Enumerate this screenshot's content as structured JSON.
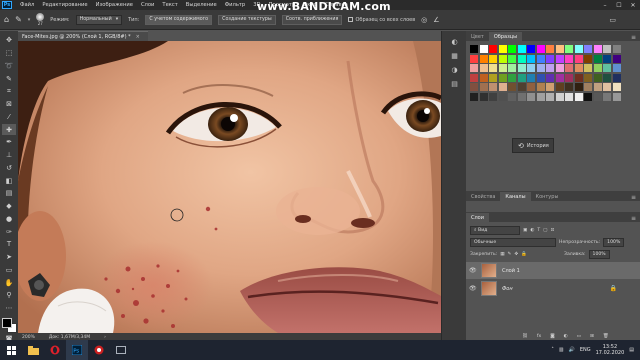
{
  "app": {
    "logo": "Ps"
  },
  "menu": [
    "Файл",
    "Редактирование",
    "Изображение",
    "Слои",
    "Текст",
    "Выделение",
    "Фильтр",
    "3D",
    "Просмотр",
    "Окно",
    "Справка"
  ],
  "watermark": "www.BANDICAM.com",
  "options": {
    "brush_size": "27",
    "mode_label": "Режим:",
    "mode_value": "Нормальный",
    "type_label": "Тип:",
    "btn_content": "С учетом содержимого",
    "btn_texture": "Создание текстуры",
    "btn_approx": "Соотв. приближения",
    "sample_all": "Образец со всех слоев"
  },
  "document": {
    "tab_title": "Face-Mites.jpg @ 200% (Слой 1, RGB/8#) *",
    "close": "×"
  },
  "status": {
    "zoom": "200%",
    "doc_info": "Док: 1,67M/3,34M"
  },
  "swatches_panel": {
    "tabs": [
      "Цвет",
      "Образцы"
    ],
    "active": 1
  },
  "swatch_colors": [
    [
      "#000000",
      "#ffffff",
      "#ff0000",
      "#ffff00",
      "#00ff00",
      "#00ffff",
      "#0000ff",
      "#ff00ff",
      "#ff8040",
      "#ffc080",
      "#80ff80",
      "#80ffff",
      "#8080ff",
      "#ff80ff",
      "#c0c0c0",
      "#808080"
    ],
    [
      "#ff4040",
      "#ff8000",
      "#ffd000",
      "#c0ff00",
      "#40ff40",
      "#00ffc0",
      "#00c0ff",
      "#4080ff",
      "#8040ff",
      "#c040ff",
      "#ff40c0",
      "#ff4080",
      "#804000",
      "#008040",
      "#004080",
      "#400080"
    ],
    [
      "#f0a0a0",
      "#f0c090",
      "#f0e090",
      "#d0f090",
      "#a0f0a0",
      "#90f0d0",
      "#90d0f0",
      "#a0b0f0",
      "#c0a0f0",
      "#f0a0e0",
      "#e07070",
      "#e09060",
      "#d0c060",
      "#90d060",
      "#60c0a0",
      "#6090d0"
    ],
    [
      "#c04040",
      "#c06020",
      "#b0a020",
      "#70a020",
      "#30a040",
      "#20a080",
      "#2080b0",
      "#3050b0",
      "#6030b0",
      "#a030a0",
      "#a03060",
      "#703020",
      "#806020",
      "#406020",
      "#205040",
      "#203060"
    ],
    [
      "#805040",
      "#a07050",
      "#c09070",
      "#e0b090",
      "#705030",
      "#504030",
      "#906040",
      "#b08050",
      "#d0a070",
      "#604020",
      "#403020",
      "#302010",
      "#a08060",
      "#c0a080",
      "#e0c0a0",
      "#f0e0c0"
    ],
    [
      "#202020",
      "#303030",
      "#404040",
      "#505050",
      "#606060",
      "#707070",
      "#909090",
      "#a0a0a0",
      "#b0b0b0",
      "#d0d0d0",
      "#e0e0e0",
      "#f0f0f0",
      "#101010",
      "#585858",
      "#787878",
      "#989898"
    ]
  ],
  "history": {
    "label": "История"
  },
  "properties_panel": {
    "tabs": [
      "Свойства",
      "Каналы",
      "Контуры"
    ],
    "active": 1
  },
  "layers_panel": {
    "title": "Слои",
    "filter": "Вид",
    "blend": "Обычные",
    "opacity_label": "Непрозрачность:",
    "opacity": "100%",
    "lock_label": "Закрепить:",
    "fill_label": "Заливка:",
    "fill": "100%",
    "layers": [
      {
        "name": "Слой 1"
      },
      {
        "name": "Фон"
      }
    ]
  },
  "taskbar": {
    "lang": "ENG",
    "time": "13:52",
    "date": "17.02.2020"
  }
}
